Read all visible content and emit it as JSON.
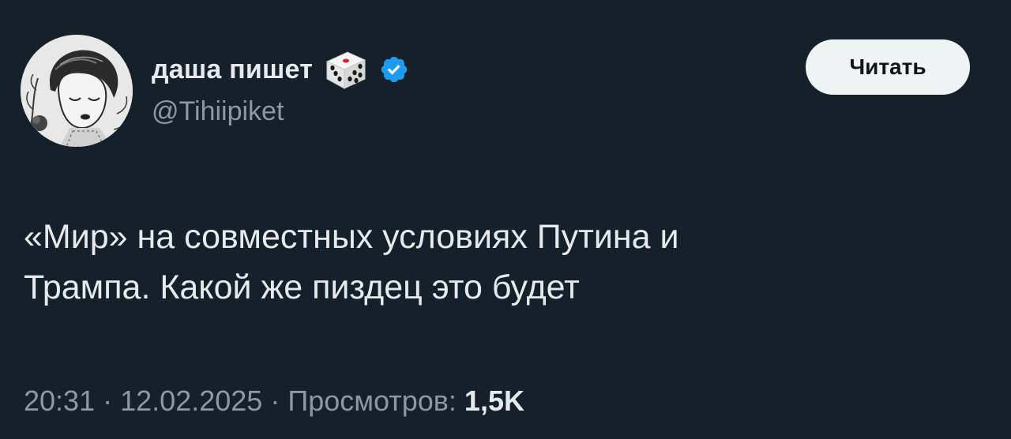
{
  "author": {
    "display_name": "даша пишет",
    "handle": "@Tihiipiket",
    "name_emoji_icon": "game-die-icon",
    "verified_icon": "verified-badge-icon"
  },
  "follow_button": {
    "label": "Читать"
  },
  "tweet": {
    "text": "«Мир» на совместных условиях Путина и\nТрампа. Какой же пиздец это будет"
  },
  "meta": {
    "time": "20:31",
    "separator": "·",
    "date": "12.02.2025",
    "views_label": "Просмотров:",
    "views_count": "1,5K"
  },
  "colors": {
    "background": "#15202b",
    "primary_text": "#e7e9ea",
    "secondary_text": "#8b98a5",
    "verified": "#1d9bf0",
    "button_bg": "#eff3f4",
    "button_text": "#0f1419"
  }
}
